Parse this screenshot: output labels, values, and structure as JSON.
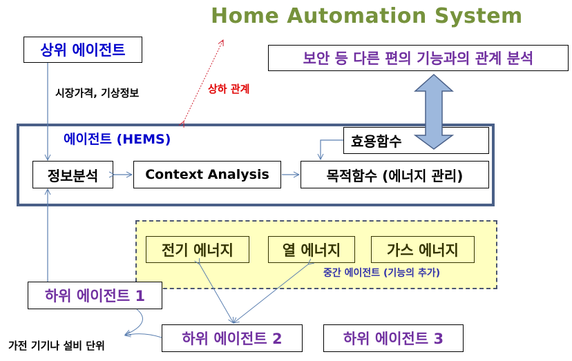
{
  "diagram": {
    "title": "Home Automation System",
    "upper_agent": {
      "label": "상위 에이전트"
    },
    "market_info": "시장가격, 기상정보",
    "hierarchy_relation": "상하 관계",
    "security_analysis": {
      "label": "보안 등 다른 편의 기능과의 관계 분석"
    },
    "hems": {
      "label": "에이전트 (HEMS)",
      "info_analysis": "정보분석",
      "context_analysis": "Context Analysis",
      "utility_function": "효용함수",
      "objective_function": "목적함수 (에너지 관리)"
    },
    "middle_agents": {
      "caption": "중간 에이전트 (기능의 추가)",
      "items": [
        "전기 에너지",
        "열 에너지",
        "가스 에너지"
      ]
    },
    "lower_agents": [
      "하위 에이전트 1",
      "하위 에이전트 2",
      "하위 에이전트 3"
    ],
    "appliance_unit": "가전 기기나 설비 단위"
  },
  "colors": {
    "title": "#76923c",
    "upper_agent_text": "#0000cc",
    "lower_agent_text": "#7030a0",
    "relation_red": "#e00000",
    "hems_frame": "#4a6088",
    "middle_fill": "#ffffc0",
    "double_arrow_fill": "#9db8dd"
  }
}
